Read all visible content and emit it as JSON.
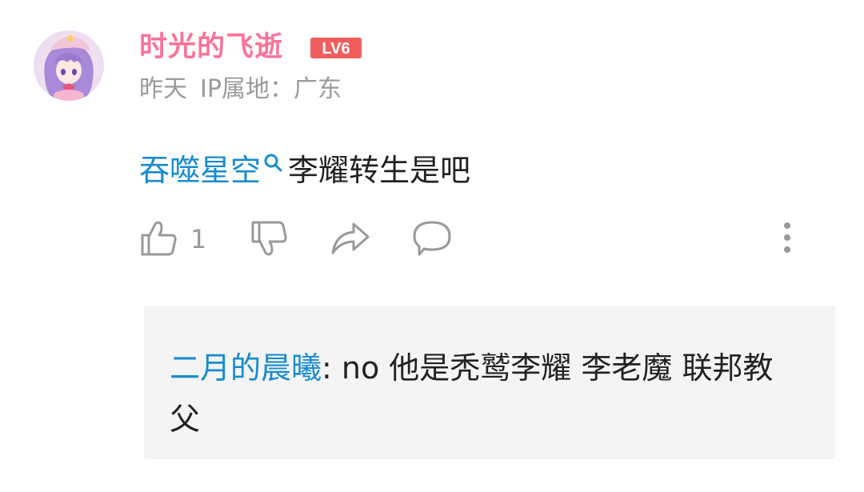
{
  "comment": {
    "author": {
      "name": "时光的飞逝",
      "level": "LV6",
      "name_color": "#fb7299",
      "level_color": "#f25d5d"
    },
    "meta": {
      "time": "昨天",
      "ip_location": "IP属地：广东"
    },
    "body": {
      "keyword": "吞噬星空",
      "keyword_icon": "search-icon",
      "text": "李耀转生是吧"
    },
    "actions": {
      "like_icon": "thumbs-up-icon",
      "like_count": "1",
      "dislike_icon": "thumbs-down-icon",
      "share_icon": "share-icon",
      "reply_icon": "comment-bubble-icon",
      "more_icon": "more-vertical-icon"
    },
    "reply": {
      "user": "二月的晨曦",
      "text": ": no 他是秃鹫李耀 李老魔 联邦教父"
    },
    "link_color": "#178bcf"
  }
}
